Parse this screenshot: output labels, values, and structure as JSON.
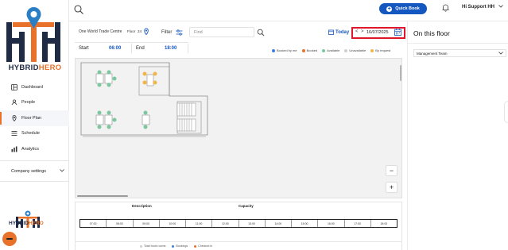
{
  "brand": {
    "logo_text_a": "HYBRID",
    "logo_text_b": "HERO",
    "color_navy": "#1f2a44",
    "color_orange": "#e8722a",
    "color_blue": "#2a7fc4"
  },
  "sidebar": {
    "items": [
      {
        "label": "Dashboard",
        "icon": "dashboard-icon"
      },
      {
        "label": "People",
        "icon": "people-icon"
      },
      {
        "label": "Floor Plan",
        "icon": "floor-plan-icon"
      },
      {
        "label": "Schedule",
        "icon": "schedule-icon"
      },
      {
        "label": "Analytics",
        "icon": "analytics-icon"
      }
    ],
    "company_settings": "Company settings"
  },
  "header": {
    "quick_book": "Quick Book",
    "user_name": "Hi Support HH"
  },
  "filters": {
    "building": "One World Trade Centre",
    "floor_label": "Floor",
    "floor_number": "24",
    "filter_label": "Filter",
    "find_placeholder": "Find",
    "today_label": "Today",
    "date_prev": "<",
    "date_next": ">",
    "date_value": "16/07/2025"
  },
  "times": {
    "start_label": "Start",
    "start_value": "06:00",
    "end_label": "End",
    "end_value": "18:00"
  },
  "legend": [
    {
      "label": "Booked by me",
      "color": "#3d7fd6"
    },
    {
      "label": "Booked",
      "color": "#e8722a"
    },
    {
      "label": "Available",
      "color": "#7cc7a0"
    },
    {
      "label": "Unavailable",
      "color": "#cfcfcf"
    },
    {
      "label": "By request",
      "color": "#f0b64a"
    }
  ],
  "zoom": {
    "out": "−",
    "in": "+"
  },
  "bottom_table": {
    "description_header": "Description",
    "capacity_header": "Capacity",
    "timeline": [
      "07:00",
      "08:00",
      "09:00",
      "10:00",
      "11:00",
      "12:00",
      "13:00",
      "14:00",
      "15:00",
      "16:00",
      "17:00",
      "18:00"
    ]
  },
  "bottom_legend": [
    {
      "label": "Total book rooms",
      "color": "#cfcfcf"
    },
    {
      "label": "Bookings",
      "color": "#3d7fd6"
    },
    {
      "label": "Checked in",
      "color": "#e8722a"
    }
  ],
  "right_panel": {
    "title": "On this floor",
    "team_select": "Management Team"
  }
}
